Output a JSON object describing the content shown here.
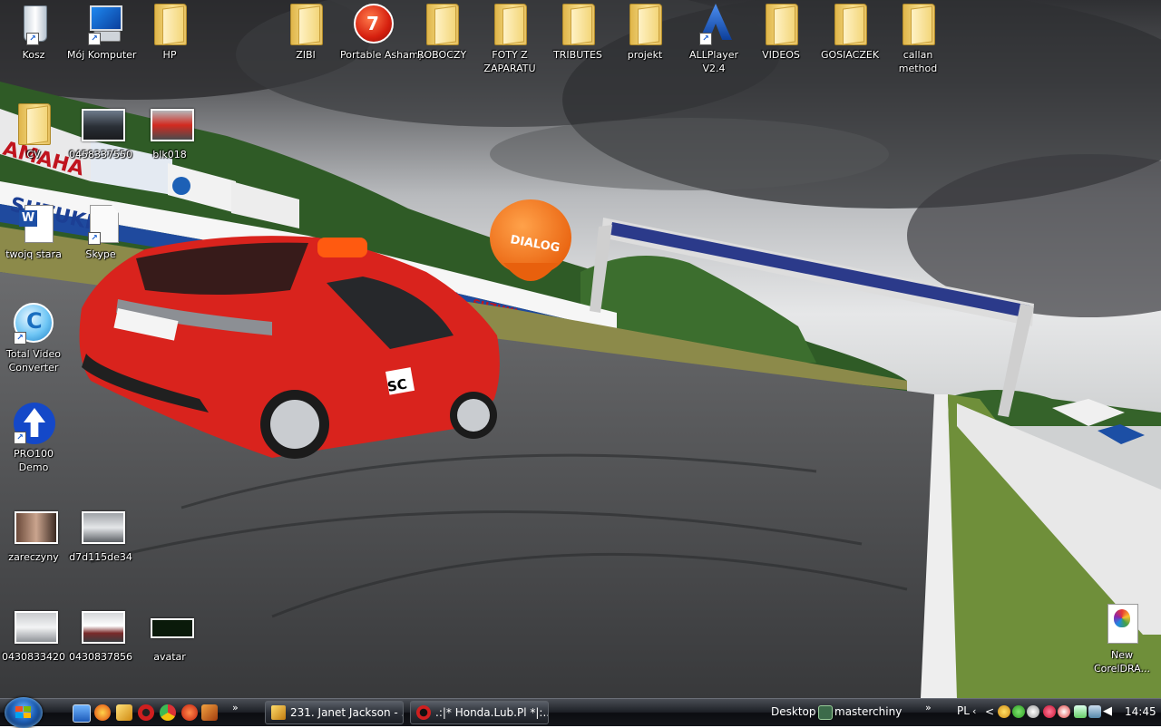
{
  "desktop": {
    "icons": [
      {
        "label": "Kosz",
        "icon": "recycle-bin-icon"
      },
      {
        "label": "Mój Komputer",
        "icon": "computer-icon"
      },
      {
        "label": "HP",
        "icon": "folder-icon"
      },
      {
        "label": "ZIBI",
        "icon": "folder-icon"
      },
      {
        "label": "Portable Ashamp...",
        "icon": "ashampoo-burning-icon"
      },
      {
        "label": "ROBOCZY",
        "icon": "folder-icon"
      },
      {
        "label": "FOTY Z ZAPARATU",
        "icon": "folder-icon"
      },
      {
        "label": "TRIBUTES",
        "icon": "folder-icon"
      },
      {
        "label": "projekt",
        "icon": "folder-icon"
      },
      {
        "label": "ALLPlayer V2.4",
        "icon": "allplayer-icon"
      },
      {
        "label": "VIDEOS",
        "icon": "folder-icon"
      },
      {
        "label": "GOSIACZEK",
        "icon": "folder-icon"
      },
      {
        "label": "callan method",
        "icon": "folder-icon"
      },
      {
        "label": "CV",
        "icon": "folder-icon"
      },
      {
        "label": "0458337550",
        "icon": "image-thumbnail-icon"
      },
      {
        "label": "blk018",
        "icon": "image-thumbnail-icon"
      },
      {
        "label": "twojq stara",
        "icon": "word-document-icon"
      },
      {
        "label": "Skype",
        "icon": "file-icon"
      },
      {
        "label": "Total Video Converter",
        "icon": "video-converter-icon"
      },
      {
        "label": "PRO100 Demo",
        "icon": "upload-arrow-icon"
      },
      {
        "label": "zareczyny",
        "icon": "image-thumbnail-icon"
      },
      {
        "label": "d7d115de34",
        "icon": "image-thumbnail-icon"
      },
      {
        "label": "0430833420",
        "icon": "image-thumbnail-icon"
      },
      {
        "label": "0430837856",
        "icon": "image-thumbnail-icon"
      },
      {
        "label": "avatar",
        "icon": "image-thumbnail-icon"
      },
      {
        "label": "New CorelDRA...",
        "icon": "coreldraw-icon"
      }
    ]
  },
  "taskbar": {
    "start_icon": "windows-logo-icon",
    "quick_launch_overflow": "»",
    "tasks": [
      {
        "label": "231. Janet Jackson - ...",
        "icon": "winamp-icon"
      },
      {
        "label": ".:|* Honda.Lub.Pl *|:....",
        "icon": "opera-icon"
      }
    ],
    "toolbar_overflow": "»",
    "desktop_toolbar": "Desktop",
    "masterchiny_label": "masterchiny",
    "tray_overflow": "»",
    "language": "PL",
    "clock": "14:45"
  }
}
